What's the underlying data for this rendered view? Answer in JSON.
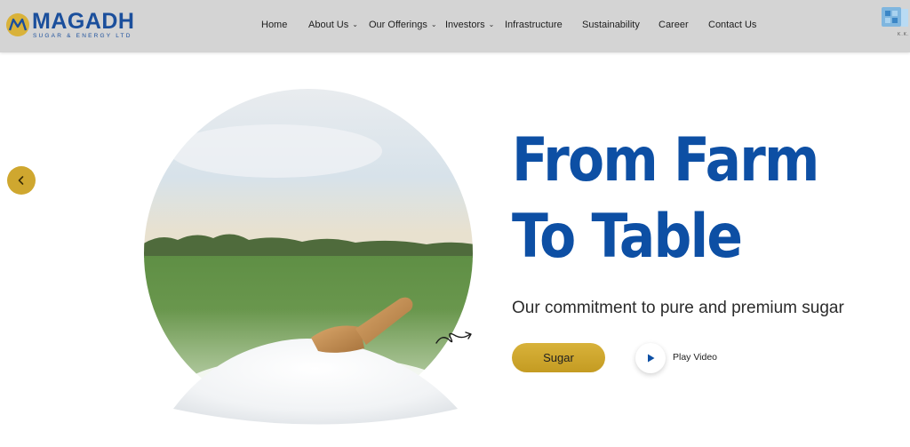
{
  "header": {
    "logo": {
      "wordmark": "MAGADH",
      "tagline": "SUGAR & ENERGY LTD"
    },
    "nav": [
      {
        "label": "Home",
        "has_dropdown": false
      },
      {
        "label": "About Us",
        "has_dropdown": true
      },
      {
        "label": "Our Offerings",
        "has_dropdown": true
      },
      {
        "label": "Investors",
        "has_dropdown": true
      },
      {
        "label": "Infrastructure",
        "has_dropdown": false
      },
      {
        "label": "Sustainability",
        "has_dropdown": false
      },
      {
        "label": "Career",
        "has_dropdown": false
      },
      {
        "label": "Contact Us",
        "has_dropdown": false
      }
    ],
    "corner_logo_text": "K.K."
  },
  "hero": {
    "prev_icon": "chevron-left-icon",
    "title_line1": "From Farm",
    "title_line2": "To Table",
    "subtitle": "Our commitment to pure and premium sugar",
    "cta_label": "Sugar",
    "play_label": "Play Video",
    "play_icon": "play-icon"
  },
  "colors": {
    "header_bg": "#d4d4d4",
    "brand_blue": "#0d4fa4",
    "gold": "#cfa72f",
    "text_dark": "#2b2b2b"
  }
}
